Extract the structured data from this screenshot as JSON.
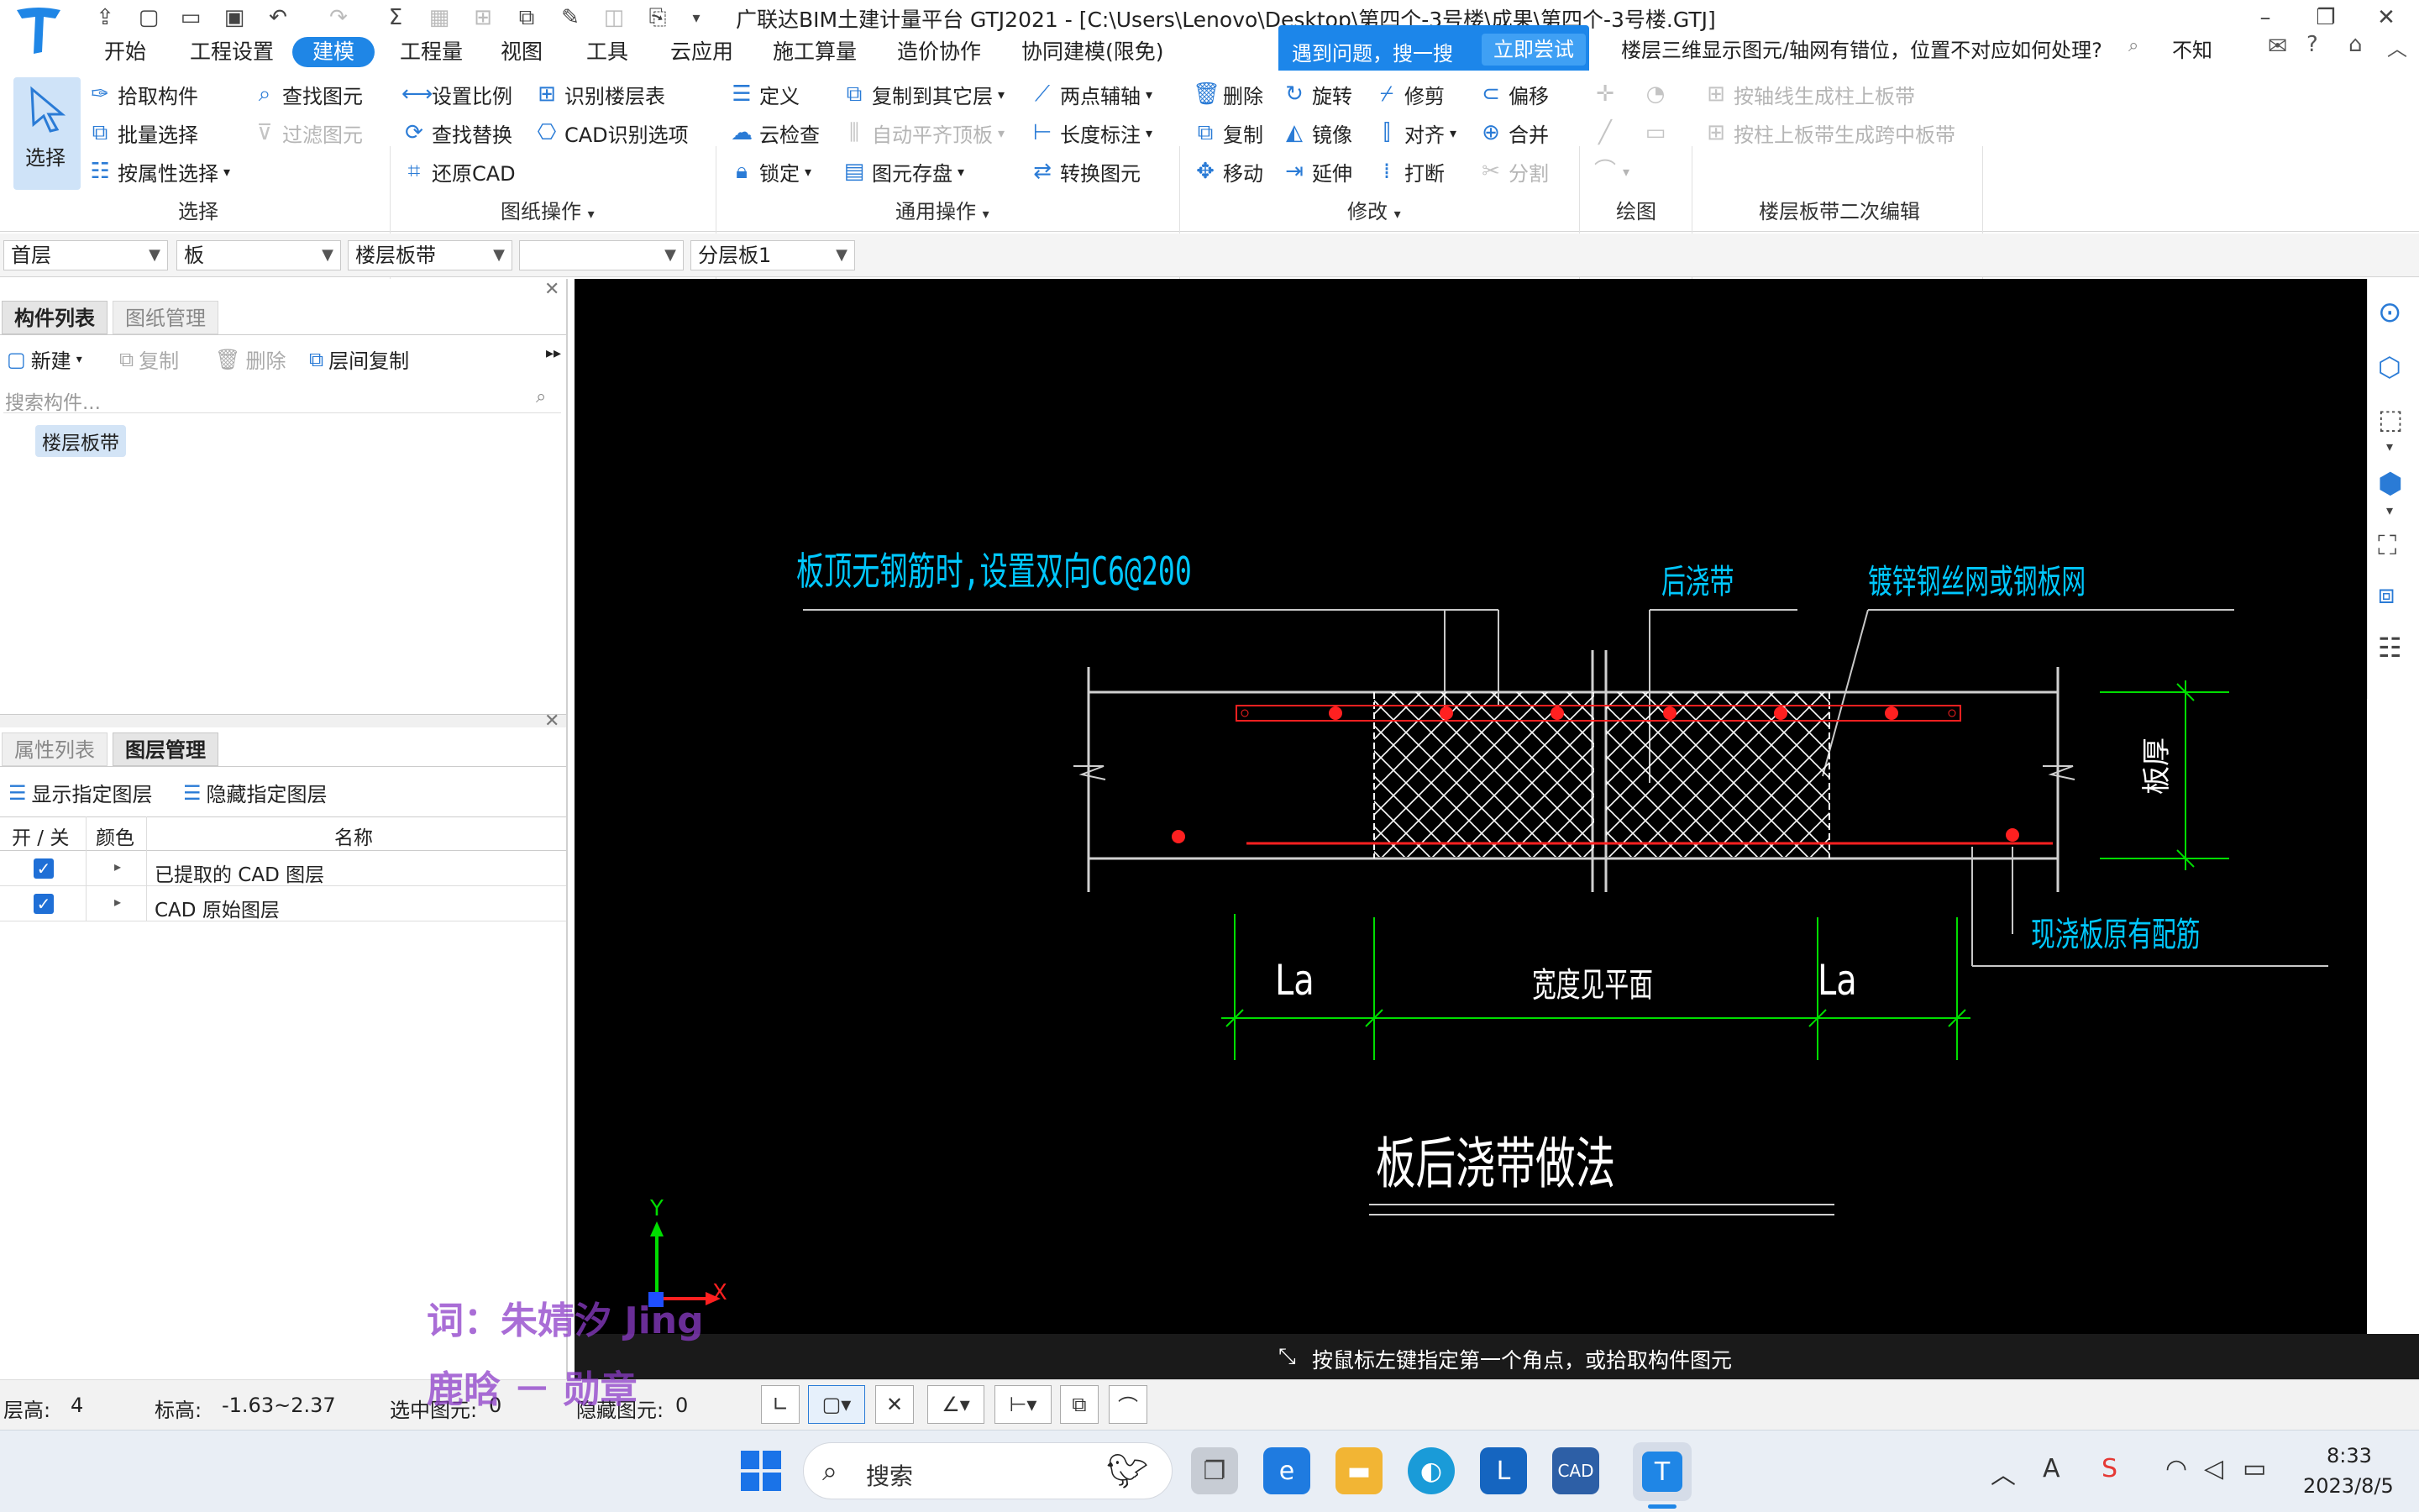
{
  "app": {
    "title": "广联达BIM土建计量平台 GTJ2021 - [C:\\Users\\Lenovo\\Desktop\\第四个-3号楼\\成果\\第四个-3号楼.GTJ]",
    "logo_letter": "T"
  },
  "menu": [
    "开始",
    "工程设置",
    "建模",
    "工程量",
    "视图",
    "工具",
    "云应用",
    "施工算量",
    "造价协作",
    "协同建模(限免)"
  ],
  "active_menu": "建模",
  "search_banner": {
    "text": "遇到问题，搜一搜",
    "button": "立即尝试"
  },
  "search_query": "楼层三维显示图元/轴网有错位，位置不对应如何处理?",
  "not_know": "不知",
  "ribbon": {
    "select_label": "选择",
    "select_group": "选择",
    "select_items": [
      "拾取构件",
      "批量选择",
      "按属性选择",
      "查找图元",
      "过滤图元"
    ],
    "drawing_items": [
      "设置比例",
      "识别楼层表",
      "查找替换",
      "CAD识别选项",
      "还原CAD"
    ],
    "drawing_group": "图纸操作",
    "general_items": [
      "定义",
      "复制到其它层",
      "两点辅轴",
      "云检查",
      "自动平齐顶板",
      "长度标注",
      "锁定",
      "图元存盘",
      "转换图元"
    ],
    "general_group": "通用操作",
    "modify_items": [
      "删除",
      "旋转",
      "修剪",
      "偏移",
      "复制",
      "镜像",
      "对齐",
      "合并",
      "移动",
      "延伸",
      "打断",
      "分割"
    ],
    "modify_group": "修改",
    "draw_group": "绘图",
    "slab_items": [
      "按轴线生成柱上板带",
      "按柱上板带生成跨中板带"
    ],
    "slab_group": "楼层板带二次编辑"
  },
  "dropdowns": [
    "首层",
    "板",
    "楼层板带",
    "",
    "分层板1"
  ],
  "left_panel": {
    "tabs_top": [
      "构件列表",
      "图纸管理"
    ],
    "toolbar": [
      "新建",
      "复制",
      "删除",
      "层间复制"
    ],
    "search_placeholder": "搜索构件...",
    "component": "楼层板带",
    "tabs_bottom": [
      "属性列表",
      "图层管理"
    ],
    "layer_buttons": [
      "显示指定图层",
      "隐藏指定图层"
    ],
    "columns": [
      "开 / 关",
      "颜色",
      "名称"
    ],
    "layers": [
      {
        "name": "已提取的 CAD 图层",
        "on": true
      },
      {
        "name": "CAD 原始图层",
        "on": true
      }
    ]
  },
  "cad": {
    "note1": "板顶无钢筋时,设置双向C6@200",
    "note2": "后浇带",
    "note3": "镀锌钢丝网或钢板网",
    "note4": "现浇板原有配筋",
    "dim_left": "La",
    "dim_mid": "宽度见平面",
    "dim_right": "La",
    "dim_vert": "板厚",
    "title": "板后浇带做法",
    "axis_x": "X",
    "axis_y": "Y"
  },
  "cad_prompt": "按鼠标左键指定第一个角点，或拾取构件图元",
  "status": {
    "floor_height_label": "层高:",
    "floor_height": "4",
    "elevation_label": "标高:",
    "elevation": "-1.63~2.37",
    "selected_label": "选中图元:",
    "selected": "0",
    "hidden_label": "隐藏图元:",
    "hidden": "0"
  },
  "watermark": [
    "词：朱婧汐 Jing",
    "鹿晗 － 勋章"
  ],
  "taskbar": {
    "search": "搜索",
    "time": "8:33",
    "date": "2023/8/5"
  },
  "colors": {
    "accent": "#1f86e6",
    "cad_bg": "#000000",
    "cad_cyan": "#00c8ff",
    "cad_red": "#ff2020",
    "cad_green": "#00dd00"
  }
}
